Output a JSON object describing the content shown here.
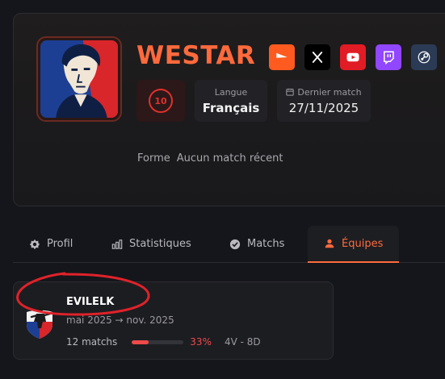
{
  "player": {
    "name": "WESTAR",
    "level": "10",
    "language_label": "Langue",
    "language_value": "Français",
    "last_match_label": "Dernier match",
    "last_match_value": "27/11/2025",
    "form_label": "Forme",
    "form_value": "Aucun match récent"
  },
  "socials": [
    {
      "icon": "faceit-icon",
      "color": "#ff5a1f"
    },
    {
      "icon": "x-icon",
      "color": "#000000"
    },
    {
      "icon": "youtube-icon",
      "color": "#e11c24"
    },
    {
      "icon": "twitch-icon",
      "color": "#9146ff"
    },
    {
      "icon": "steam-icon",
      "color": "#2b3b55"
    }
  ],
  "tabs": [
    {
      "label": "Profil",
      "icon": "gear-star-icon"
    },
    {
      "label": "Statistiques",
      "icon": "bar-chart-icon"
    },
    {
      "label": "Matchs",
      "icon": "check-circle-icon"
    },
    {
      "label": "Équipes",
      "icon": "user-icon",
      "active": true
    }
  ],
  "team": {
    "name": "EVILELK",
    "period": "mai 2025 → nov. 2025",
    "matches": "12 matchs",
    "winrate_pct": "33%",
    "winrate_fraction": 0.33,
    "record": "4V - 8D"
  },
  "colors": {
    "accent": "#ff6a3d",
    "level": "#e0312b",
    "winrate": "#ee4a4a",
    "annotation": "#e0222a"
  }
}
